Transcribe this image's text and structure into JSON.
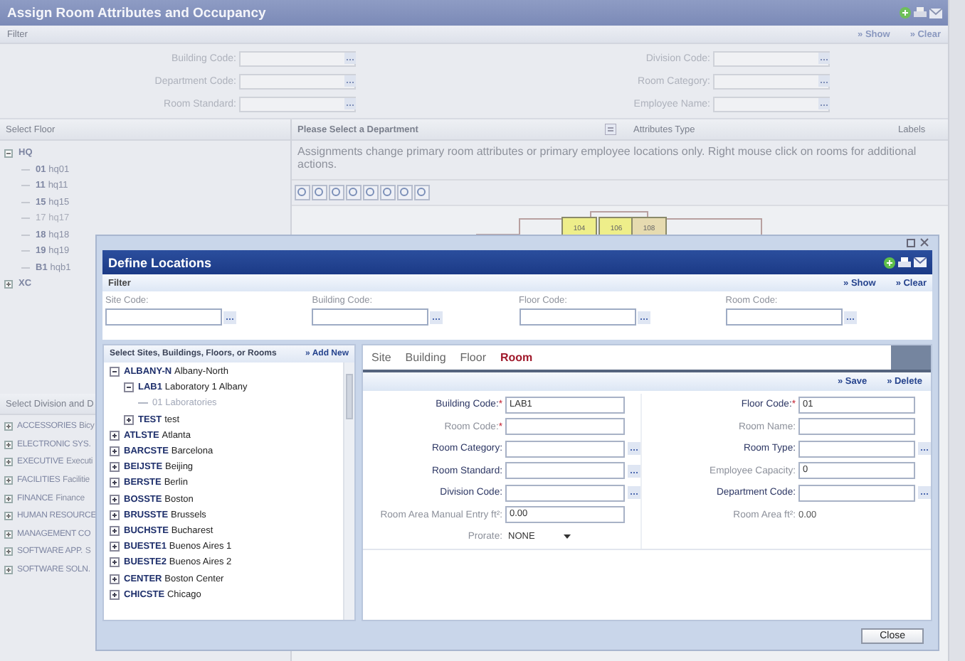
{
  "window": {
    "title": "Assign Room Attributes and Occupancy"
  },
  "filter": {
    "title": "Filter",
    "actions": [
      "» Show",
      "» Clear"
    ],
    "fields": [
      {
        "label": "Building Code:"
      },
      {
        "label": "Division Code:"
      },
      {
        "label": "Department Code:"
      },
      {
        "label": "Room Category:"
      },
      {
        "label": "Room Standard:"
      },
      {
        "label": "Employee Name:"
      }
    ]
  },
  "floor_panel": {
    "title": "Select Floor",
    "tree": [
      {
        "code": "HQ",
        "expanded": true,
        "disabled": false,
        "children": [
          {
            "code": "01",
            "name": "hq01",
            "disabled": false
          },
          {
            "code": "11",
            "name": "hq11",
            "disabled": false
          },
          {
            "code": "15",
            "name": "hq15",
            "disabled": false
          },
          {
            "code": "17",
            "name": "hq17",
            "disabled": true
          },
          {
            "code": "18",
            "name": "hq18",
            "disabled": false
          },
          {
            "code": "19",
            "name": "hq19",
            "disabled": false
          },
          {
            "code": "B1",
            "name": "hqb1",
            "disabled": false
          }
        ]
      },
      {
        "code": "XC",
        "expanded": false,
        "disabled": false
      }
    ]
  },
  "division_panel": {
    "title": "Select Division and D",
    "items": [
      {
        "code": "ACCESSORIES",
        "name": "Bicy",
        "expanded": false
      },
      {
        "code": "ELECTRONIC SYS.",
        "expanded": false
      },
      {
        "code": "EXECUTIVE",
        "name": "Executi",
        "expanded": false
      },
      {
        "code": "FACILITIES",
        "name": "Facilitie",
        "expanded": false
      },
      {
        "code": "FINANCE",
        "name": "Finance",
        "expanded": false
      },
      {
        "code": "HUMAN RESOURCE",
        "expanded": false
      },
      {
        "code": "MANAGEMENT CO",
        "expanded": false
      },
      {
        "code": "SOFTWARE APP.",
        "name": "S",
        "expanded": false
      },
      {
        "code": "SOFTWARE SOLN.",
        "expanded": false
      }
    ]
  },
  "drawing_panel": {
    "title": "Please Select a Department",
    "columns": [
      "Attributes Type",
      "Labels"
    ],
    "message": "Assignments change primary room attributes or primary employee locations only. Right mouse click on rooms for additional actions.",
    "rooms": [
      {
        "label": "104",
        "color": "#eeee8a"
      },
      {
        "label": "106",
        "color": "#eeee8a"
      },
      {
        "label": "108",
        "color": "#e6dbb0"
      }
    ]
  },
  "dialog": {
    "title": "Define Locations",
    "filter": {
      "title": "Filter",
      "actions": [
        "» Show",
        "» Clear"
      ],
      "fields": [
        {
          "label": "Site Code:"
        },
        {
          "label": "Building Code:"
        },
        {
          "label": "Floor Code:"
        },
        {
          "label": "Room Code:"
        }
      ]
    },
    "tree": {
      "title": "Select Sites, Buildings, Floors, or Rooms",
      "action": "» Add New",
      "items": [
        {
          "code": "ALBANY-N",
          "name": "Albany-North",
          "expanded": true,
          "disabled": false,
          "children": [
            {
              "code": "LAB1",
              "name": "Laboratory 1 Albany",
              "expanded": true,
              "disabled": false,
              "children": [
                {
                  "code": "01",
                  "name": "Laboratories",
                  "disabled": true
                }
              ]
            },
            {
              "code": "TEST",
              "name": "test",
              "expanded": false,
              "disabled": false
            }
          ]
        },
        {
          "code": "ATLSTE",
          "name": "Atlanta",
          "expanded": false,
          "disabled": false
        },
        {
          "code": "BARCSTE",
          "name": "Barcelona",
          "expanded": false,
          "disabled": false
        },
        {
          "code": "BEIJSTE",
          "name": "Beijing",
          "expanded": false,
          "disabled": false
        },
        {
          "code": "BERSTE",
          "name": "Berlin",
          "expanded": false,
          "disabled": false
        },
        {
          "code": "BOSSTE",
          "name": "Boston",
          "expanded": false,
          "disabled": false
        },
        {
          "code": "BRUSSTE",
          "name": "Brussels",
          "expanded": false,
          "disabled": false
        },
        {
          "code": "BUCHSTE",
          "name": "Bucharest",
          "expanded": false,
          "disabled": false
        },
        {
          "code": "BUESTE1",
          "name": "Buenos Aires 1",
          "expanded": false,
          "disabled": false
        },
        {
          "code": "BUESTE2",
          "name": "Buenos Aires 2",
          "expanded": false,
          "disabled": false
        },
        {
          "code": "CENTER",
          "name": "Boston Center",
          "expanded": false,
          "disabled": false
        },
        {
          "code": "CHICSTE",
          "name": "Chicago",
          "expanded": false,
          "disabled": false
        }
      ]
    },
    "tabs": [
      {
        "label": "Site",
        "selected": false
      },
      {
        "label": "Building",
        "selected": false
      },
      {
        "label": "Floor",
        "selected": false
      },
      {
        "label": "Room",
        "selected": true
      }
    ],
    "form": {
      "actions": [
        "» Save",
        "» Delete"
      ],
      "fields": [
        {
          "label": "Building Code:",
          "mark": "*",
          "strong": true,
          "kind": "text",
          "value": "LAB1"
        },
        {
          "label": "Floor Code:",
          "mark": "*",
          "strong": true,
          "kind": "text",
          "value": "01"
        },
        {
          "label": "Room Code:",
          "mark": "*",
          "strong": false,
          "kind": "text"
        },
        {
          "label": "Room Name:",
          "strong": false,
          "kind": "text"
        },
        {
          "label": "Room Category:",
          "strong": true,
          "kind": "lookup"
        },
        {
          "label": "Room Type:",
          "strong": true,
          "kind": "lookup"
        },
        {
          "label": "Room Standard:",
          "strong": true,
          "kind": "lookup"
        },
        {
          "label": "Employee Capacity:",
          "strong": false,
          "kind": "text",
          "value": "0"
        },
        {
          "label": "Division Code:",
          "strong": true,
          "kind": "lookup"
        },
        {
          "label": "Department Code:",
          "strong": true,
          "kind": "lookup"
        },
        {
          "label": "Room Area Manual Entry ft²:",
          "strong": false,
          "kind": "text",
          "value": "0.00"
        },
        {
          "label": "Room Area ft²:",
          "strong": false,
          "kind": "value",
          "value": "0.00"
        },
        {
          "label": "Prorate:",
          "strong": false,
          "kind": "select",
          "value": "NONE"
        }
      ]
    },
    "close_button": "Close"
  }
}
